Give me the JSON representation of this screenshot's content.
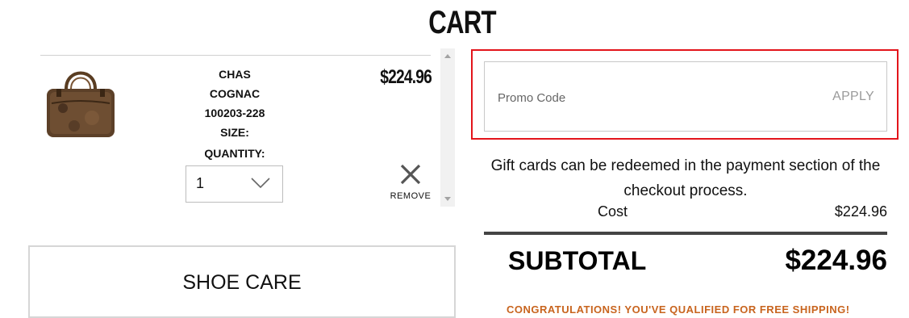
{
  "header": {
    "title": "CART"
  },
  "cart": {
    "item": {
      "name": "CHAS",
      "color": "COGNAC",
      "sku": "100203-228",
      "size_label": "SIZE:",
      "quantity_label": "QUANTITY:",
      "quantity": "1",
      "price": "$224.96",
      "remove_label": "REMOVE"
    }
  },
  "shoe_care": {
    "label": "SHOE CARE"
  },
  "promo": {
    "placeholder": "Promo Code",
    "apply_label": "APPLY"
  },
  "summary": {
    "gift_note": "Gift cards can be redeemed in the payment section of the checkout process.",
    "cost_label": "Cost",
    "cost_value": "$224.96",
    "subtotal_label": "SUBTOTAL",
    "subtotal_value": "$224.96",
    "shipping_message": "CONGRATULATIONS! YOU'VE QUALIFIED FOR FREE SHIPPING!"
  },
  "colors": {
    "highlight": "#e3141b",
    "shipping_message": "#c8641e"
  },
  "icons": [
    "chevron-down-icon",
    "close-icon",
    "scroll-up-arrow-icon",
    "scroll-down-arrow-icon"
  ]
}
